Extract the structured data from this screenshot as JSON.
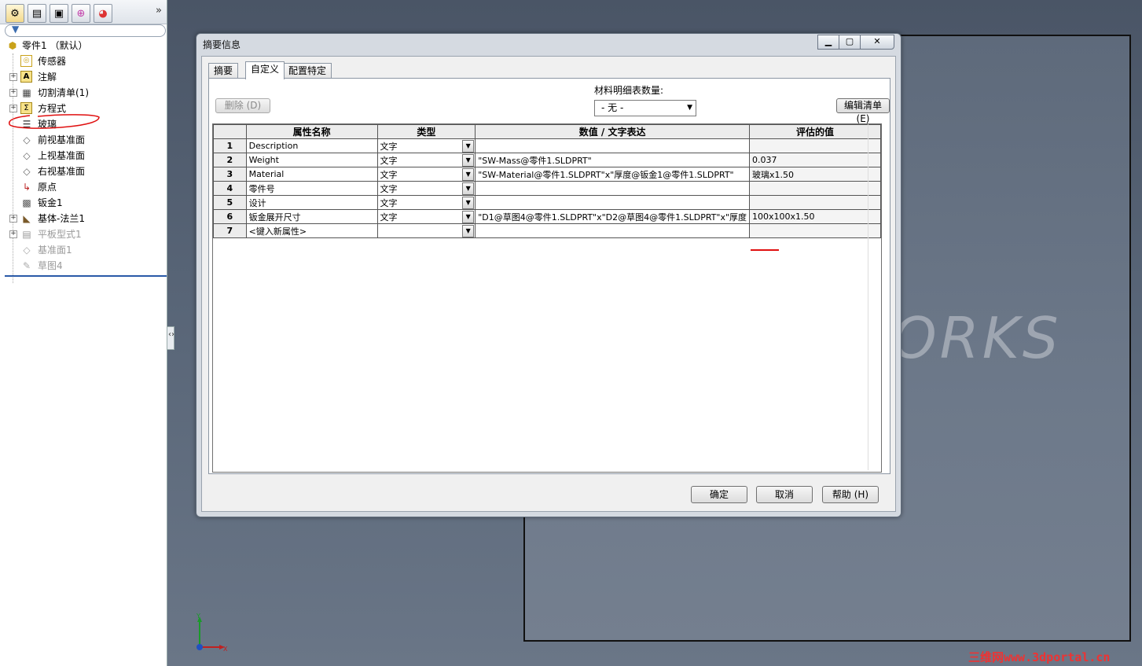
{
  "fm": {
    "root": "零件1 （默认）",
    "items": [
      {
        "label": "传感器",
        "icon": "sensor-icon",
        "expand": false
      },
      {
        "label": "注解",
        "icon": "annotation-icon",
        "expand": true
      },
      {
        "label": "切割清单(1)",
        "icon": "cutlist-icon",
        "expand": true
      },
      {
        "label": "方程式",
        "icon": "equation-icon",
        "expand": true
      },
      {
        "label": "玻璃",
        "icon": "material-icon",
        "expand": false
      },
      {
        "label": "前视基准面",
        "icon": "plane-icon",
        "expand": false
      },
      {
        "label": "上视基准面",
        "icon": "plane-icon",
        "expand": false
      },
      {
        "label": "右视基准面",
        "icon": "plane-icon",
        "expand": false
      },
      {
        "label": "原点",
        "icon": "origin-icon",
        "expand": false
      },
      {
        "label": "钣金1",
        "icon": "sheetmetal-icon",
        "expand": false
      },
      {
        "label": "基体-法兰1",
        "icon": "base-flange-icon",
        "expand": true
      },
      {
        "label": "平板型式1",
        "icon": "flat-pattern-icon",
        "expand": true
      },
      {
        "label": "基准面1",
        "icon": "plane-icon",
        "expand": false
      },
      {
        "label": "草图4",
        "icon": "sketch-icon",
        "expand": false
      }
    ]
  },
  "dialog": {
    "title": "摘要信息",
    "tabs": [
      "摘要",
      "自定义",
      "配置特定"
    ],
    "delete_button": "删除 (D)",
    "bom_label": "材料明细表数量:",
    "bom_value": "- 无 -",
    "edit_list_button": "编辑清单 (E)",
    "columns": [
      "属性名称",
      "类型",
      "数值 / 文字表达",
      "评估的值"
    ],
    "rows": [
      {
        "num": "1",
        "name": "Description",
        "type": "文字",
        "value": "",
        "evaluated": ""
      },
      {
        "num": "2",
        "name": "Weight",
        "type": "文字",
        "value": "\"SW-Mass@零件1.SLDPRT\"",
        "evaluated": "0.037"
      },
      {
        "num": "3",
        "name": "Material",
        "type": "文字",
        "value": "\"SW-Material@零件1.SLDPRT\"x\"厚度@钣金1@零件1.SLDPRT\"",
        "evaluated": "玻璃x1.50"
      },
      {
        "num": "4",
        "name": "零件号",
        "type": "文字",
        "value": "",
        "evaluated": ""
      },
      {
        "num": "5",
        "name": "设计",
        "type": "文字",
        "value": "",
        "evaluated": ""
      },
      {
        "num": "6",
        "name": "钣金展开尺寸",
        "type": "文字",
        "value": "\"D1@草图4@零件1.SLDPRT\"x\"D2@草图4@零件1.SLDPRT\"x\"厚度",
        "evaluated": "100x100x1.50"
      },
      {
        "num": "7",
        "name": "<键入新属性>",
        "type": "",
        "value": "",
        "evaluated": ""
      }
    ],
    "ok_button": "确定",
    "cancel_button": "取消",
    "help_button": "帮助 (H)"
  },
  "viewport": {
    "watermark": "ORKS",
    "axis_y": "Y",
    "axis_x": "X",
    "site": "三维网www.3dportal.cn"
  }
}
